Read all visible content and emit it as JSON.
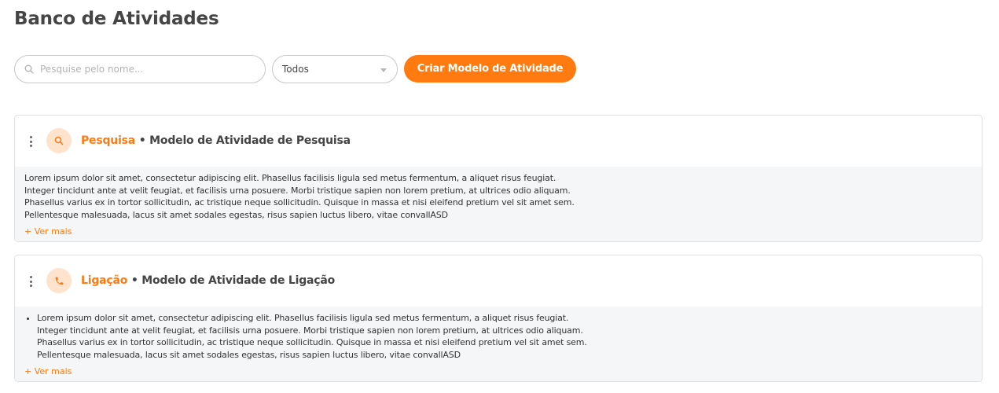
{
  "page": {
    "title": "Banco de Atividades"
  },
  "toolbar": {
    "search_placeholder": "Pesquise pelo nome...",
    "filter_selected": "Todos",
    "create_button_label": "Criar Modelo de Atividade"
  },
  "colors": {
    "accent": "#ff7a10",
    "icon_bg": "#ffe3cc"
  },
  "cards": [
    {
      "icon": "search-icon",
      "type_label": "Pesquisa",
      "separator": " • ",
      "title": "Modelo de Atividade de Pesquisa",
      "description_lines": [
        "Lorem ipsum dolor sit amet, consectetur adipiscing elit. Phasellus facilisis ligula sed metus fermentum, a aliquet risus feugiat.",
        "Integer tincidunt ante at velit feugiat, et facilisis urna posuere. Morbi tristique sapien non lorem pretium, at ultrices odio aliquam.",
        "Phasellus varius ex in tortor sollicitudin, ac tristique neque sollicitudin. Quisque in massa et nisi eleifend pretium vel sit amet sem.",
        "Pellentesque malesuada, lacus sit amet sodales egestas, risus sapien luctus libero, vitae convallASD"
      ],
      "more_label": "+ Ver mais"
    },
    {
      "icon": "phone-icon",
      "type_label": "Ligação",
      "separator": " • ",
      "title": "Modelo de Atividade de Ligação",
      "description_lines": [
        "Lorem ipsum dolor sit amet, consectetur adipiscing elit. Phasellus facilisis ligula sed metus fermentum, a aliquet risus feugiat.",
        "Integer tincidunt ante at velit feugiat, et facilisis urna posuere. Morbi tristique sapien non lorem pretium, at ultrices odio aliquam.",
        "Phasellus varius ex in tortor sollicitudin, ac tristique neque sollicitudin. Quisque in massa et nisi eleifend pretium vel sit amet sem.",
        "Pellentesque malesuada, lacus sit amet sodales egestas, risus sapien luctus libero, vitae convallASD"
      ],
      "more_label": "+ Ver mais"
    }
  ]
}
